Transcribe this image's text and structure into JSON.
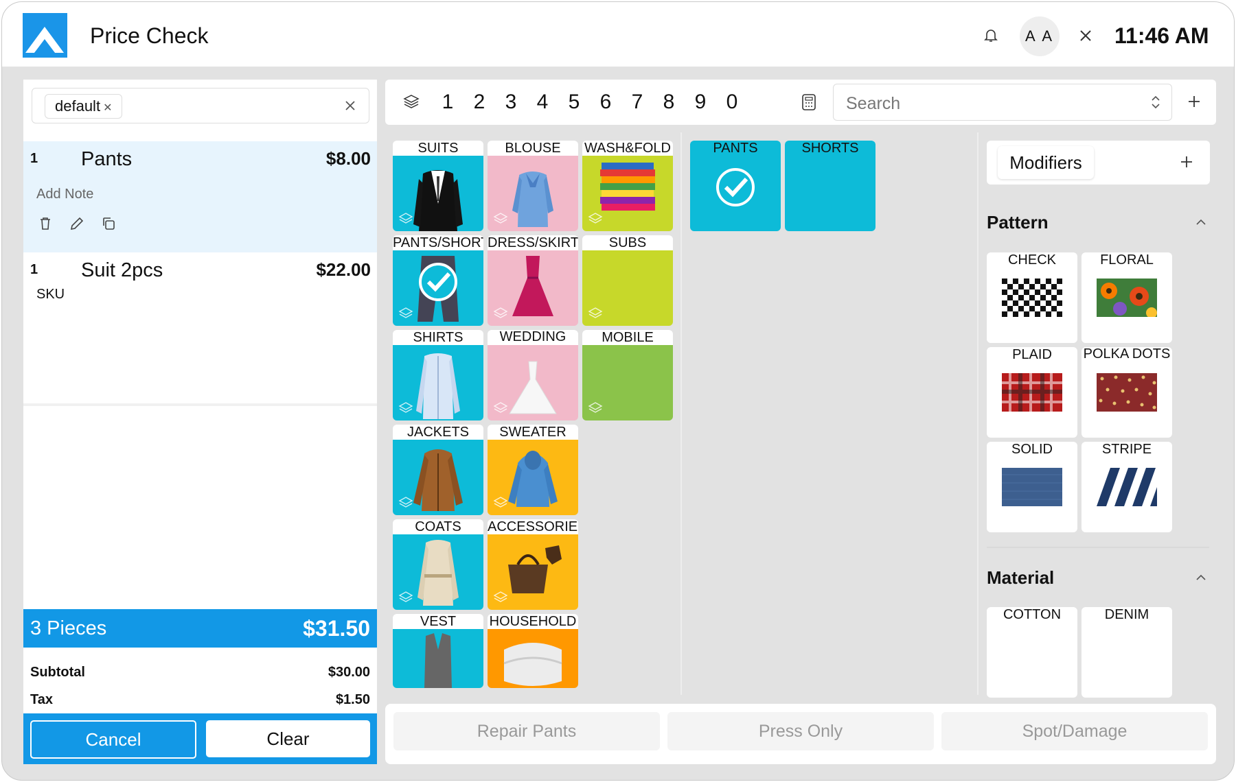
{
  "header": {
    "title": "Price Check",
    "avatar_initials": "A A",
    "time": "11:46 AM"
  },
  "customer": {
    "tag": "default"
  },
  "order": {
    "items": [
      {
        "qty": "1",
        "name": "Pants",
        "price": "$8.00",
        "note": "Add Note"
      },
      {
        "qty": "1",
        "name": "Suit 2pcs",
        "price": "$22.00",
        "sub": "SKU"
      }
    ],
    "pieces_label": "3 Pieces",
    "total": "$31.50",
    "subtotal_label": "Subtotal",
    "subtotal": "$30.00",
    "tax_label": "Tax",
    "tax": "$1.50",
    "cancel_label": "Cancel",
    "clear_label": "Clear"
  },
  "toolbar": {
    "numbers": [
      "1",
      "2",
      "3",
      "4",
      "5",
      "6",
      "7",
      "8",
      "9",
      "0"
    ],
    "search_placeholder": "Search"
  },
  "categories": [
    "SUITS",
    "BLOUSE",
    "WASH&FOLD",
    "PANTS/SHORTS",
    "DRESS/SKIRT",
    "SUBS",
    "SHIRTS",
    "WEDDING DRESS",
    "MOBILE",
    "JACKETS",
    "SWEATER",
    "COATS",
    "ACCESSORIES",
    "VEST",
    "HOUSEHOLD"
  ],
  "subcategories": [
    "PANTS",
    "SHORTS"
  ],
  "modifiers": {
    "title": "Modifiers",
    "pattern_title": "Pattern",
    "patterns": [
      "CHECK",
      "FLORAL",
      "PLAID",
      "POLKA DOTS",
      "SOLID",
      "STRIPE"
    ],
    "material_title": "Material",
    "materials": [
      "COTTON",
      "DENIM"
    ]
  },
  "quick_actions": [
    "Repair Pants",
    "Press Only",
    "Spot/Damage"
  ],
  "colors": {
    "accent": "#1298e6",
    "cyan": "#0dbbd8",
    "pink": "#f2b9c9",
    "lime": "#c7d82a",
    "green": "#8bc34a",
    "yellow": "#fdb913",
    "orange": "#ff9800"
  }
}
